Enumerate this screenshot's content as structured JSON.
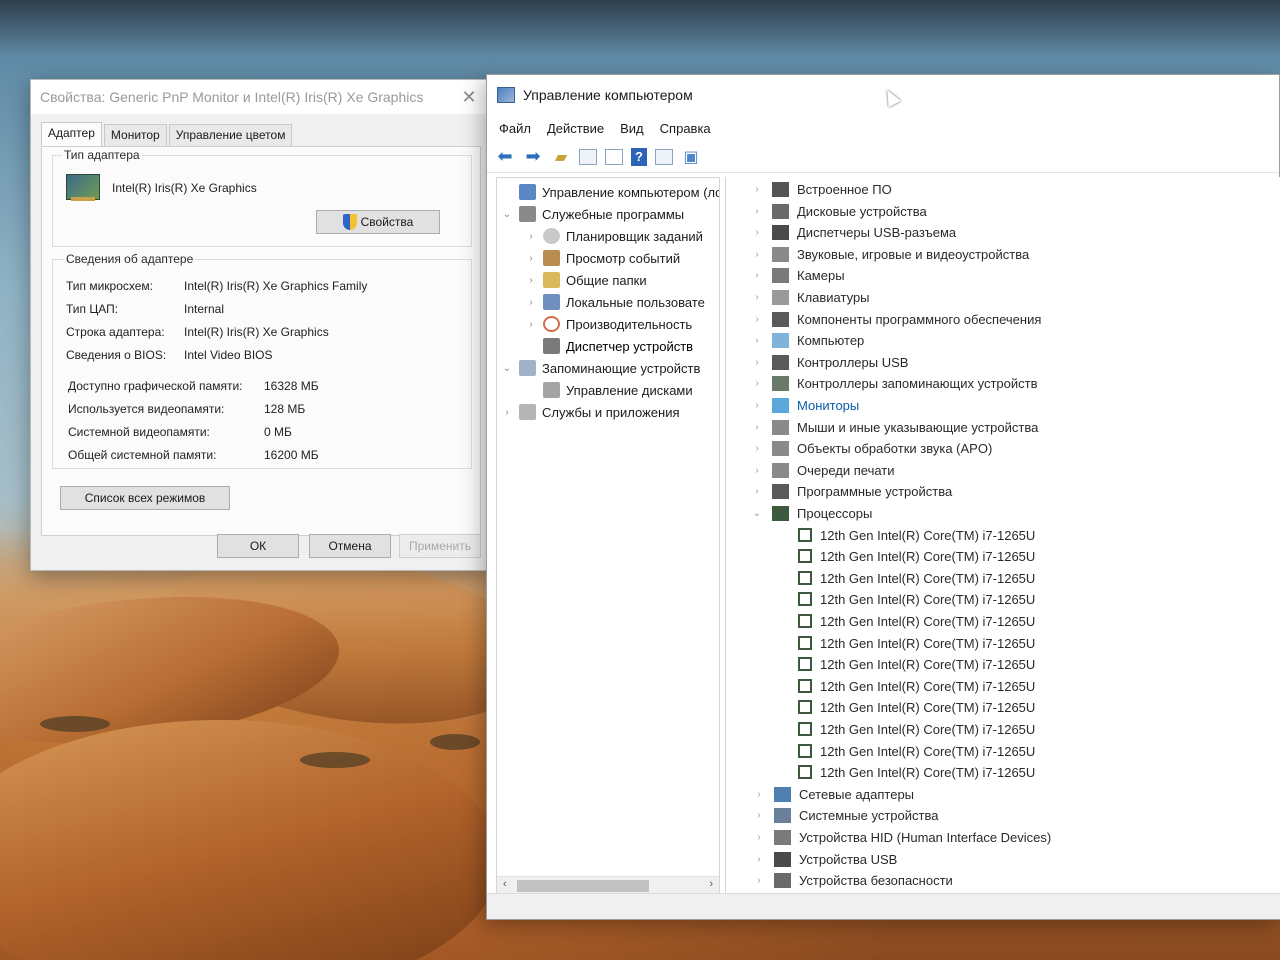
{
  "dialog": {
    "title": "Свойства: Generic PnP Monitor и Intel(R) Iris(R) Xe Graphics",
    "tabs": [
      "Адаптер",
      "Монитор",
      "Управление цветом"
    ],
    "adapter_type_label": "Тип адаптера",
    "adapter_name": "Intel(R) Iris(R) Xe Graphics",
    "properties_button": "Свойства",
    "adapter_info_label": "Сведения об адаптере",
    "info": [
      {
        "key": "Тип микросхем:",
        "value": "Intel(R) Iris(R) Xe Graphics Family"
      },
      {
        "key": "Тип ЦАП:",
        "value": "Internal"
      },
      {
        "key": "Строка адаптера:",
        "value": "Intel(R) Iris(R) Xe Graphics"
      },
      {
        "key": "Сведения о BIOS:",
        "value": "Intel Video BIOS"
      }
    ],
    "memory": [
      {
        "key": "Доступно графической памяти:",
        "value": "16328 МБ"
      },
      {
        "key": "Используется видеопамяти:",
        "value": "128 МБ"
      },
      {
        "key": "Системной видеопамяти:",
        "value": "0 МБ"
      },
      {
        "key": "Общей системной памяти:",
        "value": "16200 МБ"
      }
    ],
    "list_modes_button": "Список всех режимов",
    "ok_button": "ОК",
    "cancel_button": "Отмена",
    "apply_button": "Применить"
  },
  "cm": {
    "title": "Управление компьютером",
    "menu": [
      "Файл",
      "Действие",
      "Вид",
      "Справка"
    ],
    "nav": [
      {
        "label": "Управление компьютером (лс",
        "level": 0,
        "expander": "",
        "icon_color": "#5a86c4"
      },
      {
        "label": "Служебные программы",
        "level": 1,
        "expander": "⌄",
        "icon_color": "#8a8a8a"
      },
      {
        "label": "Планировщик заданий",
        "level": 2,
        "expander": "›",
        "icon_color": "#c9c9c9"
      },
      {
        "label": "Просмотр событий",
        "level": 2,
        "expander": "›",
        "icon_color": "#b98c52"
      },
      {
        "label": "Общие папки",
        "level": 2,
        "expander": "›",
        "icon_color": "#d9b95a"
      },
      {
        "label": "Локальные пользовате",
        "level": 2,
        "expander": "›",
        "icon_color": "#6f8fbf"
      },
      {
        "label": "Производительность",
        "level": 2,
        "expander": "›",
        "icon_color": "#d46a4a"
      },
      {
        "label": "Диспетчер устройств",
        "level": 2,
        "expander": "",
        "icon_color": "#7a7a7a"
      },
      {
        "label": "Запоминающие устройств",
        "level": 1,
        "expander": "⌄",
        "icon_color": "#9fb2c8"
      },
      {
        "label": "Управление дисками",
        "level": 2,
        "expander": "",
        "icon_color": "#a4a4a4"
      },
      {
        "label": "Службы и приложения",
        "level": 1,
        "expander": "›",
        "icon_color": "#b5b5b5"
      }
    ],
    "devices": [
      {
        "label": "Встроенное ПО",
        "expander": "›",
        "icon_color": "#555555",
        "highlight": false
      },
      {
        "label": "Дисковые устройства",
        "expander": "›",
        "icon_color": "#6a6a6a",
        "highlight": false
      },
      {
        "label": "Диспетчеры USB-разъема",
        "expander": "›",
        "icon_color": "#4a4a4a",
        "highlight": false
      },
      {
        "label": "Звуковые, игровые и видеоустройства",
        "expander": "›",
        "icon_color": "#8a8a8a",
        "highlight": false
      },
      {
        "label": "Камеры",
        "expander": "›",
        "icon_color": "#7a7a7a",
        "highlight": false
      },
      {
        "label": "Клавиатуры",
        "expander": "›",
        "icon_color": "#9a9a9a",
        "highlight": false
      },
      {
        "label": "Компоненты программного обеспечения",
        "expander": "›",
        "icon_color": "#5a5a5a",
        "highlight": false
      },
      {
        "label": "Компьютер",
        "expander": "›",
        "icon_color": "#7fb3d9",
        "highlight": false
      },
      {
        "label": "Контроллеры USB",
        "expander": "›",
        "icon_color": "#5a5a5a",
        "highlight": false
      },
      {
        "label": "Контроллеры запоминающих устройств",
        "expander": "›",
        "icon_color": "#6a7a6a",
        "highlight": false
      },
      {
        "label": "Мониторы",
        "expander": "›",
        "icon_color": "#5aa7d9",
        "highlight": true
      },
      {
        "label": "Мыши и иные указывающие устройства",
        "expander": "›",
        "icon_color": "#8a8a8a",
        "highlight": false
      },
      {
        "label": "Объекты обработки звука (APO)",
        "expander": "›",
        "icon_color": "#8a8a8a",
        "highlight": false
      },
      {
        "label": "Очереди печати",
        "expander": "›",
        "icon_color": "#8a8a8a",
        "highlight": false
      },
      {
        "label": "Программные устройства",
        "expander": "›",
        "icon_color": "#5a5a5a",
        "highlight": false
      },
      {
        "label": "Процессоры",
        "expander": "⌄",
        "icon_color": "#3e5a3e",
        "highlight": false
      }
    ],
    "processor": "12th Gen Intel(R) Core(TM) i7-1265U",
    "processor_count": 12,
    "devices_after": [
      {
        "label": "Сетевые адаптеры",
        "expander": "›",
        "icon_color": "#4f7fb0"
      },
      {
        "label": "Системные устройства",
        "expander": "›",
        "icon_color": "#6a7f9a"
      },
      {
        "label": "Устройства HID (Human Interface Devices)",
        "expander": "›",
        "icon_color": "#7a7a7a"
      },
      {
        "label": "Устройства USB",
        "expander": "›",
        "icon_color": "#4a4a4a"
      },
      {
        "label": "Устройства безопасности",
        "expander": "›",
        "icon_color": "#6a6a6a"
      }
    ]
  }
}
